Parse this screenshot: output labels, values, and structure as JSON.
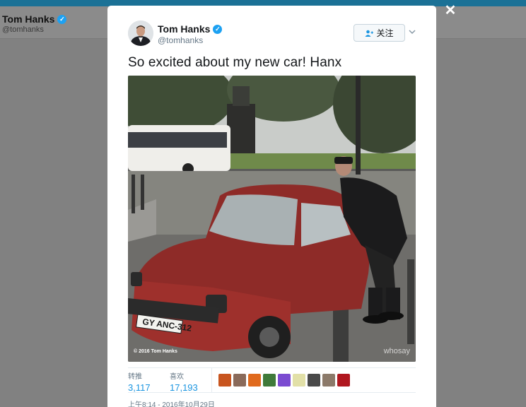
{
  "background_profile": {
    "name": "Tom Hanks",
    "handle": "@tomhanks"
  },
  "modal": {
    "close_label": "✕"
  },
  "tweet": {
    "author_name": "Tom Hanks",
    "author_handle": "@tomhanks",
    "verified_glyph": "✓",
    "follow_label": "关注",
    "menu_icon": "chevron-down-icon",
    "text": "So excited about my new car! Hanx",
    "photo": {
      "credit": "© 2016 Tom Hanks",
      "watermark": "whosay",
      "plate": "GY ANC-312"
    },
    "stats": {
      "retweets_label": "转推",
      "retweets_value": "3,117",
      "likes_label": "喜欢",
      "likes_value": "17,193"
    },
    "likers": [
      "#c8551f",
      "#8a6a5a",
      "#e06a1e",
      "#3f7a3a",
      "#7b4bd1",
      "#e2e0a8",
      "#4a4a4a",
      "#8c7a6a",
      "#b0171f"
    ],
    "timestamp": "上午8:14 - 2016年10月29日"
  },
  "colors": {
    "accent": "#1b95e0",
    "verified": "#1da1f2",
    "topbar": "#1b7196"
  }
}
